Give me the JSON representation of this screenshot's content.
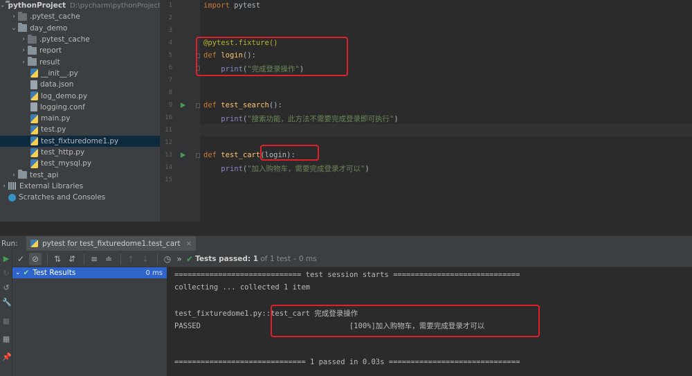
{
  "project_tree": {
    "root_name": "pythonProject",
    "root_path": "D:\\pycharm\\pythonProject",
    "items": [
      {
        "label": ".pytest_cache"
      },
      {
        "label": "day_demo"
      },
      {
        "label": ".pytest_cache"
      },
      {
        "label": "report"
      },
      {
        "label": "result"
      },
      {
        "label": "__init__.py"
      },
      {
        "label": "data.json"
      },
      {
        "label": "log_demo.py"
      },
      {
        "label": "logging.conf"
      },
      {
        "label": "main.py"
      },
      {
        "label": "test.py"
      },
      {
        "label": "test_fixturedome1.py"
      },
      {
        "label": "test_http.py"
      },
      {
        "label": "test_mysql.py"
      },
      {
        "label": "test_api"
      },
      {
        "label": "External Libraries"
      },
      {
        "label": "Scratches and Consoles"
      }
    ]
  },
  "editor": {
    "line_numbers": [
      "1",
      "2",
      "3",
      "4",
      "5",
      "6",
      "7",
      "8",
      "9",
      "10",
      "11",
      "12",
      "13",
      "14",
      "15"
    ],
    "code": {
      "l1_kw": "import",
      "l1_mod": " pytest",
      "l4_decorator": "@pytest.fixture()",
      "l5_kw": "def ",
      "l5_fn": "login",
      "l5_rest": "():",
      "l6_indent": "    ",
      "l6_print": "print",
      "l6_open": "(",
      "l6_str": "\"完成登录操作\"",
      "l6_close": ")",
      "l9_kw": "def ",
      "l9_fn": "test_search",
      "l9_rest": "():",
      "l10_indent": "    ",
      "l10_print": "print",
      "l10_open": "(",
      "l10_str": "\"搜索功能，此方法不需要完成登录即可执行\"",
      "l10_close": ")",
      "l13_kw": "def ",
      "l13_fn": "test_cart",
      "l13_rest": "(login):",
      "l14_indent": "    ",
      "l14_print": "print",
      "l14_open": "(",
      "l14_str": "\"加入购物车，需要完成登录才可以\"",
      "l14_close": ")"
    }
  },
  "run_panel": {
    "label": "Run:",
    "tab_title": "pytest for test_fixturedome1.test_cart",
    "tab_close": "×",
    "status_bold": "Tests passed: 1",
    "status_rest": " of 1 test – 0 ms",
    "more": "»",
    "test_results_label": "Test Results",
    "test_results_time": "0 ms"
  },
  "console_lines": [
    "============================= test session starts =============================",
    "collecting ... collected 1 item",
    "",
    "test_fixturedome1.py::test_cart 完成登录操作",
    "PASSED                                  [100%]加入购物车，需要完成登录才可以",
    "",
    "",
    "============================== 1 passed in 0.03s =============================="
  ],
  "colors": {
    "highlight_box": "#e0202a",
    "pass_green": "#499c54",
    "selection_blue": "#2f65ca"
  }
}
